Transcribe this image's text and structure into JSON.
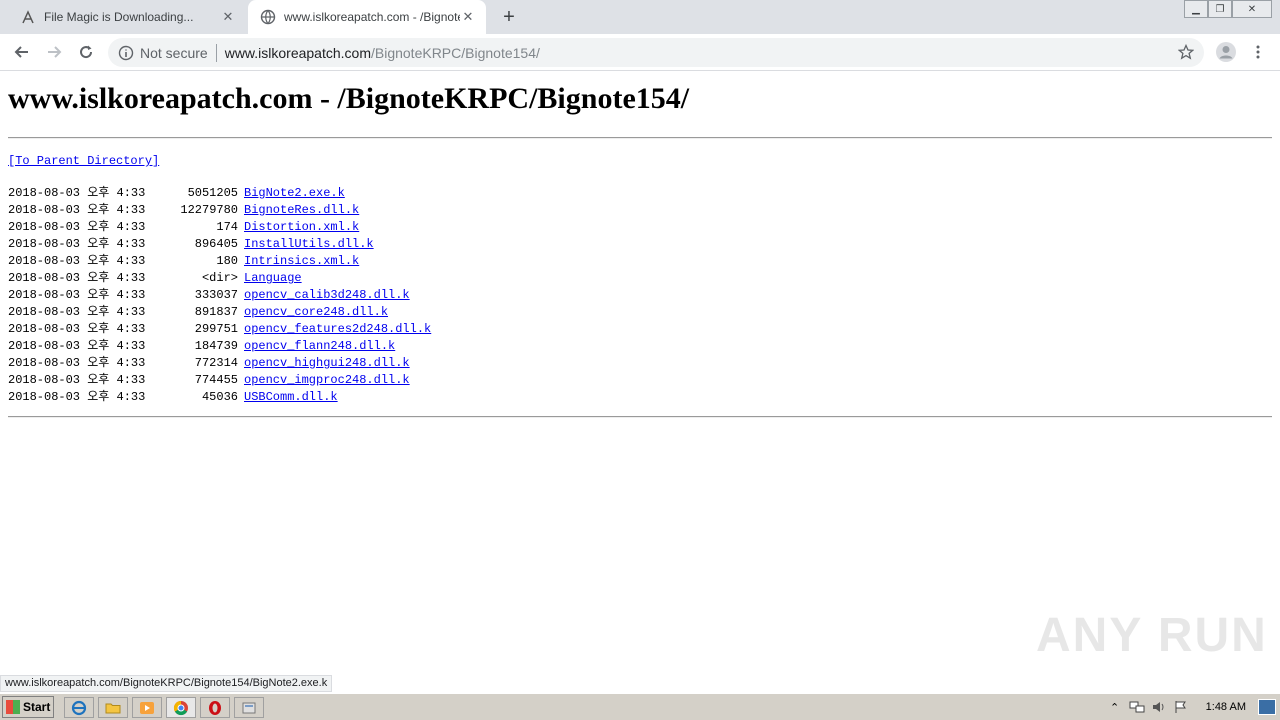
{
  "browser": {
    "tabs": [
      {
        "title": "File Magic is Downloading...",
        "active": false
      },
      {
        "title": "www.islkoreapatch.com - /BignoteKRPC",
        "active": true
      }
    ],
    "address": {
      "security_label": "Not secure",
      "host": "www.islkoreapatch.com",
      "path": "/BignoteKRPC/Bignote154/"
    }
  },
  "page": {
    "heading": "www.islkoreapatch.com - /BignoteKRPC/Bignote154/",
    "parent_link": "[To Parent Directory]",
    "entries": [
      {
        "date": "2018-08-03 오후 4:33",
        "size": "5051205",
        "name": "BigNote2.exe.k"
      },
      {
        "date": "2018-08-03 오후 4:33",
        "size": "12279780",
        "name": "BignoteRes.dll.k"
      },
      {
        "date": "2018-08-03 오후 4:33",
        "size": "174",
        "name": "Distortion.xml.k"
      },
      {
        "date": "2018-08-03 오후 4:33",
        "size": "896405",
        "name": "InstallUtils.dll.k"
      },
      {
        "date": "2018-08-03 오후 4:33",
        "size": "180",
        "name": "Intrinsics.xml.k"
      },
      {
        "date": "2018-08-03 오후 4:33",
        "size": "<dir>",
        "name": "Language"
      },
      {
        "date": "2018-08-03 오후 4:33",
        "size": "333037",
        "name": "opencv_calib3d248.dll.k"
      },
      {
        "date": "2018-08-03 오후 4:33",
        "size": "891837",
        "name": "opencv_core248.dll.k"
      },
      {
        "date": "2018-08-03 오후 4:33",
        "size": "299751",
        "name": "opencv_features2d248.dll.k"
      },
      {
        "date": "2018-08-03 오후 4:33",
        "size": "184739",
        "name": "opencv_flann248.dll.k"
      },
      {
        "date": "2018-08-03 오후 4:33",
        "size": "772314",
        "name": "opencv_highgui248.dll.k"
      },
      {
        "date": "2018-08-03 오후 4:33",
        "size": "774455",
        "name": "opencv_imgproc248.dll.k"
      },
      {
        "date": "2018-08-03 오후 4:33",
        "size": "45036",
        "name": "USBComm.dll.k"
      }
    ]
  },
  "status_bar": "www.islkoreapatch.com/BignoteKRPC/Bignote154/BigNote2.exe.k",
  "watermark": "ANY RUN",
  "taskbar": {
    "start_label": "Start",
    "clock": "1:48 AM",
    "icons": [
      "ie-icon",
      "folder-icon",
      "media-player-icon",
      "chrome-icon",
      "opera-icon",
      "app-icon"
    ]
  },
  "colors": {
    "link": "#0000ee",
    "tabstrip": "#dee1e6",
    "taskbar": "#d4d0c8"
  }
}
